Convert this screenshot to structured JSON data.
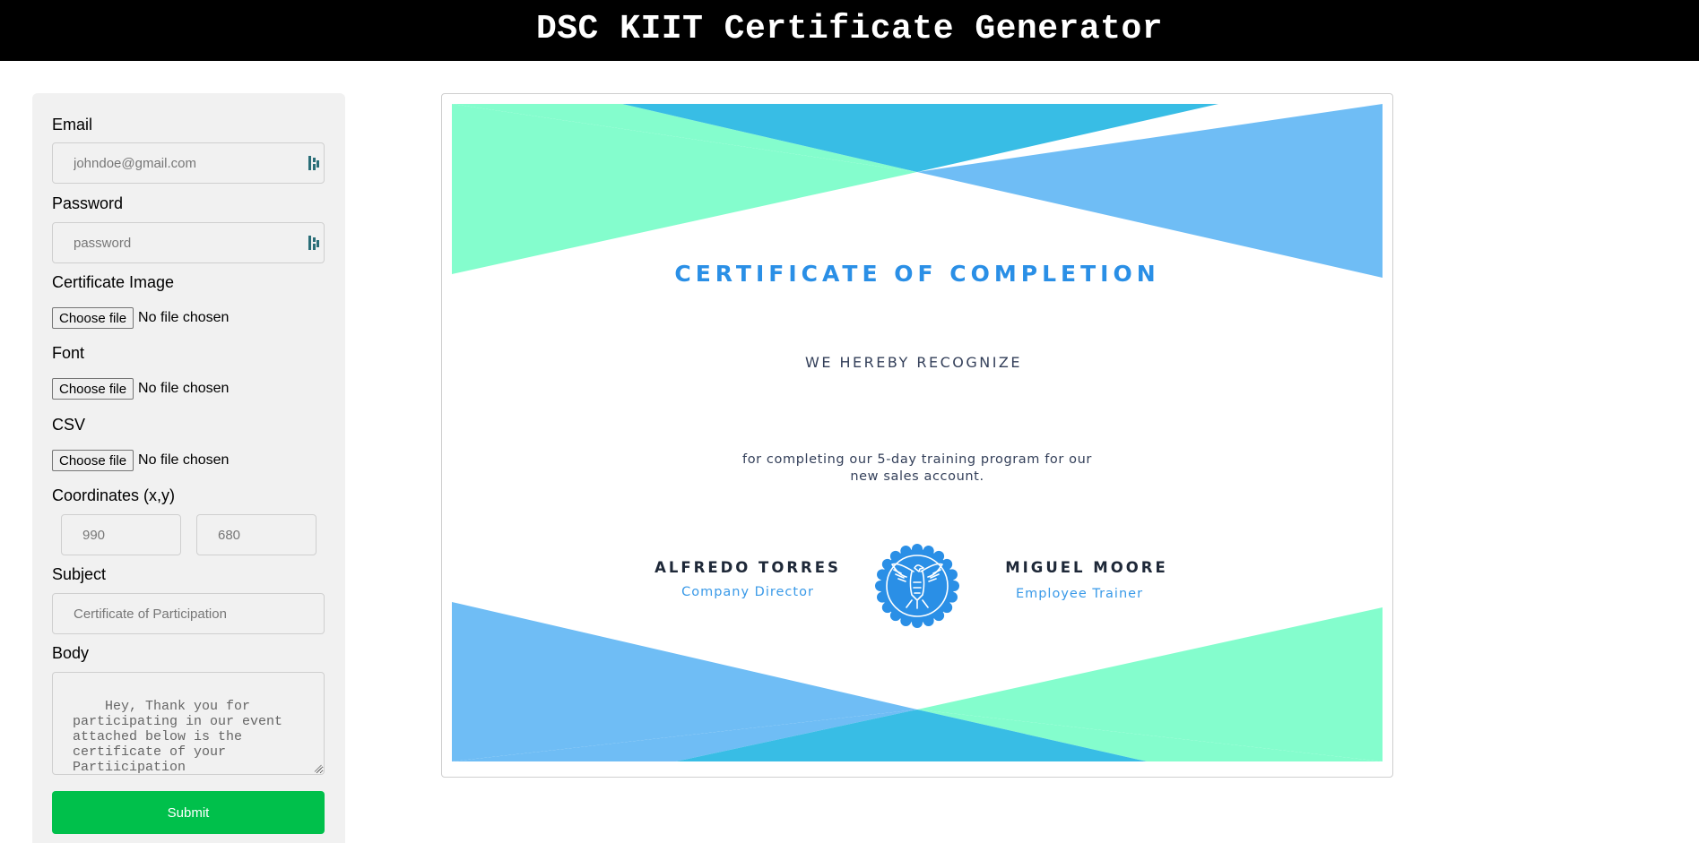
{
  "app": {
    "title": "DSC KIIT Certificate Generator"
  },
  "form": {
    "email_label": "Email",
    "email_placeholder": "johndoe@gmail.com",
    "password_label": "Password",
    "password_placeholder": "password",
    "certificate_image_label": "Certificate Image",
    "font_label": "Font",
    "csv_label": "CSV",
    "choose_file_label": "Choose file",
    "no_file_text": "No file chosen",
    "coordinates_label": "Coordinates (x,y)",
    "x_placeholder": "990",
    "y_placeholder": "680",
    "subject_label": "Subject",
    "subject_placeholder": "Certificate of Participation",
    "body_label": "Body",
    "body_text": "Hey, Thank you for participating in our event attached below is the certificate of your Partiicipation",
    "submit_label": "Submit"
  },
  "certificate": {
    "title": "CERTIFICATE OF COMPLETION",
    "recognize": "WE HEREBY RECOGNIZE",
    "description": "for completing our 5-day training program for our new sales account.",
    "signers": [
      {
        "name": "ALFREDO TORRES",
        "role": "Company Director"
      },
      {
        "name": "MIGUEL MOORE",
        "role": "Employee Trainer"
      }
    ]
  },
  "colors": {
    "header_bg": "#000000",
    "submit_bg": "#00c04b",
    "cert_blue": "#2a8fe6",
    "cert_green": "#84fdcd",
    "cert_light_blue": "#6fbdf5",
    "cert_cyan": "#38bde5"
  }
}
